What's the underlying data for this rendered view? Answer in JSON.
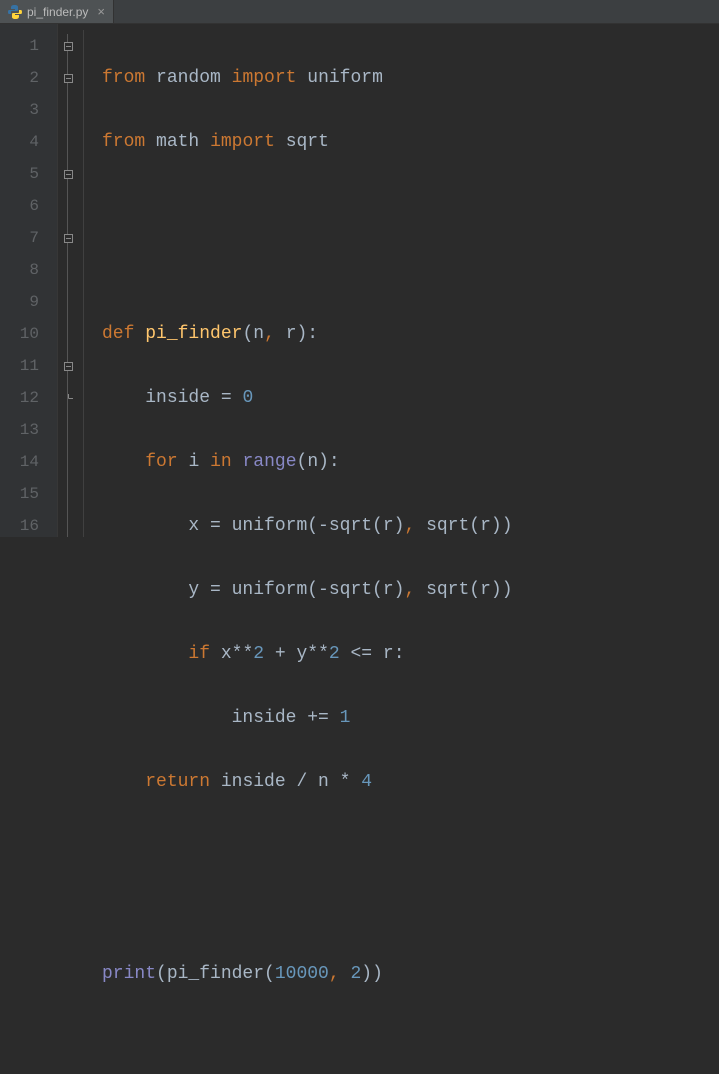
{
  "tab": {
    "filename": "pi_finder.py"
  },
  "gutter": {
    "lines": [
      "1",
      "2",
      "3",
      "4",
      "5",
      "6",
      "7",
      "8",
      "9",
      "10",
      "11",
      "12",
      "13",
      "14",
      "15",
      "16"
    ]
  },
  "code": {
    "l1": {
      "from": "from",
      "mod1": "random",
      "import": "import",
      "name1": "uniform"
    },
    "l2": {
      "from": "from",
      "mod2": "math",
      "import": "import",
      "name2": "sqrt"
    },
    "l5": {
      "def": "def",
      "fname": "pi_finder",
      "p1": "n",
      "c": ",",
      "p2": "r",
      "close": "):"
    },
    "l6": {
      "text": "inside = ",
      "zero": "0"
    },
    "l7": {
      "for": "for",
      "i": "i",
      "in": "in",
      "range": "range",
      "n": "n",
      "close": "):"
    },
    "l8": {
      "x": "x = uniform(-sqrt(r)",
      "c": ",",
      "rest": " sqrt(r))"
    },
    "l9": {
      "y": "y = uniform(-sqrt(r)",
      "c": ",",
      "rest": " sqrt(r))"
    },
    "l10": {
      "if": "if",
      "expr": "x**",
      "two1": "2",
      "plus": " + y**",
      "two2": "2",
      "le": " <= r:"
    },
    "l11": {
      "text": "inside += ",
      "one": "1"
    },
    "l12": {
      "return": "return",
      "expr": "inside / n * ",
      "four": "4"
    },
    "l15": {
      "print": "print",
      "open": "(pi_finder(",
      "n1": "10000",
      "c": ",",
      "sp": " ",
      "n2": "2",
      "close": "))"
    }
  }
}
